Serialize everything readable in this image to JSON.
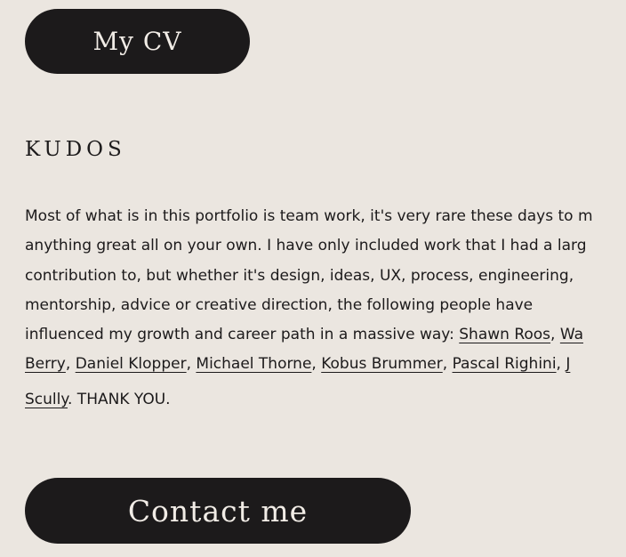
{
  "buttons": {
    "cv_label": "My CV",
    "contact_label": "Contact me"
  },
  "kudos": {
    "heading": "KUDOS",
    "line1": "Most of what is in this portfolio is team work, it's very rare these days to m",
    "line2": "anything great all on your own. I have only included work that I had a larg",
    "line3": "contribution to, but whether it's design, ideas, UX, process, engineering,",
    "line4": "mentorship, advice or creative direction, the following people have",
    "line5_text": "influenced my growth and career path in a massive way: ",
    "people": [
      "Shawn Roos",
      "Wa",
      "Berry",
      "Daniel Klopper",
      "Michael Thorne",
      "Kobus Brummer",
      "Pascal Righini",
      "J",
      "Scully"
    ],
    "thanks": ". THANK YOU."
  }
}
